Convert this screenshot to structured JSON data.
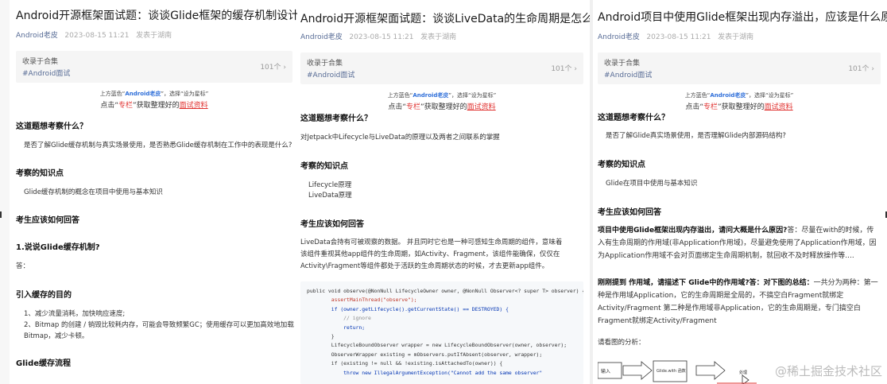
{
  "articles": [
    {
      "title": "Android开源框架面试题：谈谈Glide框架的缓存机制设计",
      "author": "Android老皮",
      "datetime": "2023-08-15 11:21",
      "location": "发表于湖南",
      "collection": {
        "label": "收录于合集",
        "tag": "#Android面试",
        "count": "101个"
      },
      "promo": {
        "line1_pre": "上方蓝色“",
        "line1_name": "Android老皮",
        "line1_post": "”，选择“设为星标”",
        "line2_pre": "点击“",
        "line2_red": "专栏",
        "line2_mid": "”获取整理好的",
        "line2_link": "面试资料"
      },
      "q1": "这道题想考察什么？",
      "a1": "是否了解Glide缓存机制与真实场景使用，是否熟悉Glide缓存机制在工作中的表现是什么?",
      "q2": "考察的知识点",
      "a2": "Glide缓存机制的概念在项目中使用与基本知识",
      "q3": "考生应该如何回答",
      "q4": "1.说说Glide缓存机制?",
      "a4": "答：",
      "q5": "引入缓存的目的",
      "a5_1": "1、减少流量消耗，加快响应速度;",
      "a5_2": "2、Bitmap 的创建 / 销毁比较耗内存，可能会导致频繁GC；使用缓存可以更加高效地加载",
      "a5_3": "Bitmap，减少卡顿。",
      "q6": "Glide缓存流程"
    },
    {
      "title": "Android开源框架面试题：谈谈LiveData的生命周期是怎么监听的?",
      "author": "Android老皮",
      "datetime": "2023-08-15 11:21",
      "location": "发表于湖南",
      "collection": {
        "label": "收录于合集",
        "tag": "#Android面试",
        "count": "101个"
      },
      "promo": {
        "line1_pre": "上方蓝色“",
        "line1_name": "Android老皮",
        "line1_post": "”，选择“设为星标”",
        "line2_pre": "点击“",
        "line2_red": "专栏",
        "line2_mid": "”获取整理好的",
        "line2_link": "面试资料"
      },
      "q1": "这道题想考察什么？",
      "a1": "对Jetpack中Lifecycle与LiveData的原理以及两者之间联系的掌握",
      "q2": "考察的知识点",
      "a2_1": "Lifecycle原理",
      "a2_2": "LiveData原理",
      "q3": "考生应该如何回答",
      "a3_1": "LiveData会持有可被观察的数据。 并且同时它也是一种可感知生命周期的组件，意味着",
      "a3_2": "该组件重视其他app组件的生命周期，如Activity、Fragment，该组件能确保，仅仅在",
      "a3_3": "Activity\\Fragment等组件都处于活跃的生命周期状态的时候，才去更新app组件。",
      "code": [
        "public void observe(@NonNull LifecycleOwner owner, @NonNull Observer<? super T> observer) {",
        "        assertMainThread(\"observe\");",
        "        if (owner.getLifecycle().getCurrentState() == DESTROYED) {",
        "            // ignore",
        "            return;",
        "        }",
        "        LifecycleBoundObserver wrapper = new LifecycleBoundObserver(owner, observer);",
        "        ObserverWrapper existing = mObservers.putIfAbsent(observer, wrapper);",
        "        if (existing != null && !existing.isAttachedTo(owner)) {",
        "            throw new IllegalArgumentException(\"Cannot add the same observer\""
      ]
    },
    {
      "title": "Android项目中使用Glide框架出现内存溢出，应该是什么原因?",
      "author": "Android老皮",
      "datetime": "2023-08-15 11:21",
      "location": "发表于湖南",
      "collection": {
        "label": "收录于合集",
        "tag": "#Android面试",
        "count": "101个"
      },
      "promo": {
        "line1_pre": "上方蓝色“",
        "line1_name": "Android老皮",
        "line1_post": "”，选择“设为星标”",
        "line2_pre": "点击“",
        "line2_red": "专栏",
        "line2_mid": "”获取整理好的",
        "line2_link": "面试资料"
      },
      "q1": "这道题想考察什么？",
      "a1": "是否了解Glide真实场景使用，是否理解Glide内部源码结构?",
      "q2": "考察的知识点",
      "a2": "Glide在项目中使用与基本知识",
      "q3": "考生应该如何回答",
      "p1_bold": "项目中使用Glide框架出现内存溢出，请问大概是什么原因?",
      "p1_rest": "答：尽量在with的时候，传入有生命周期的作用域(非Application作用域)，尽量避免使用了Application作用域，因为Application作用域不会对页面绑定生命周期机制，就回收不及时释放操作等....",
      "p2_bold": "刚刚提到 作用域，请描述下 Glide中的作用域?",
      "p2_bold2": "答：对下图的总结：",
      "p2_rest": "一共分为两种：第一种是作用域Application，它的生命周期是全局的，不搞空白Fragment就绑定Activity/Fragment 第二种是作用域非Application，它的生命周期是，专门搞空白Fragment就绑定Activity/Fragment",
      "p3": "请看图的分析：",
      "diagram": {
        "box1": "输入",
        "box2": "Glide.with 函数",
        "box3": "处理"
      },
      "watermark": "@稀土掘金技术社区"
    }
  ]
}
